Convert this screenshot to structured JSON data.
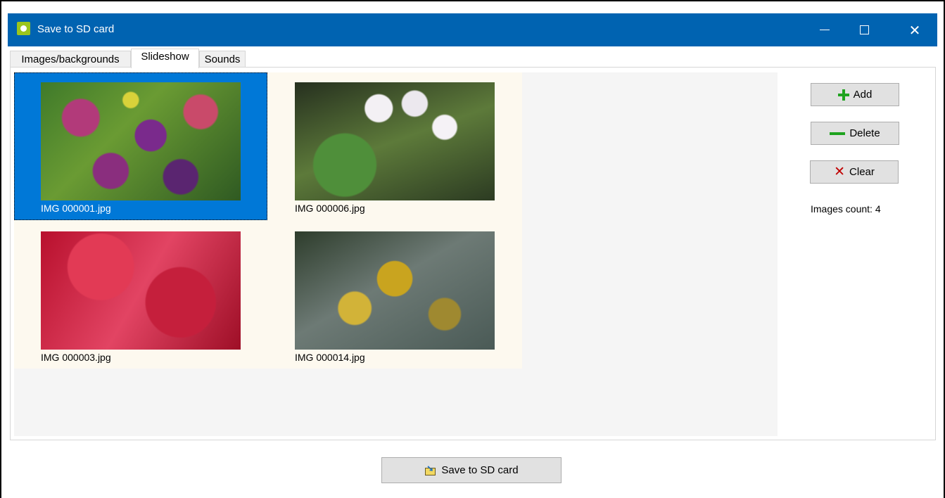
{
  "window": {
    "title": "Save to SD card",
    "controls": {
      "minimize": "—",
      "maximize": "☐",
      "close": "✕"
    }
  },
  "tabs": [
    {
      "label": "Images/backgrounds",
      "active": false
    },
    {
      "label": "Slideshow",
      "active": true
    },
    {
      "label": "Sounds",
      "active": false
    }
  ],
  "images": [
    {
      "filename": "IMG 000001.jpg",
      "selected": true,
      "thumbnail_icon": "autumn-leaves-purple-photo"
    },
    {
      "filename": "IMG 000006.jpg",
      "selected": false,
      "thumbnail_icon": "white-flowers-photo"
    },
    {
      "filename": "IMG 000003.jpg",
      "selected": false,
      "thumbnail_icon": "red-leaves-photo"
    },
    {
      "filename": "IMG 000014.jpg",
      "selected": false,
      "thumbnail_icon": "yellow-leaves-photo"
    }
  ],
  "buttons": {
    "add": "Add",
    "delete": "Delete",
    "clear": "Clear",
    "save": "Save to SD card"
  },
  "images_count": "Images count: 4",
  "colors": {
    "titlebar": "#0063b1",
    "selection": "#0078d7",
    "add_icon": "#1fa31f",
    "clear_icon": "#c00000"
  }
}
